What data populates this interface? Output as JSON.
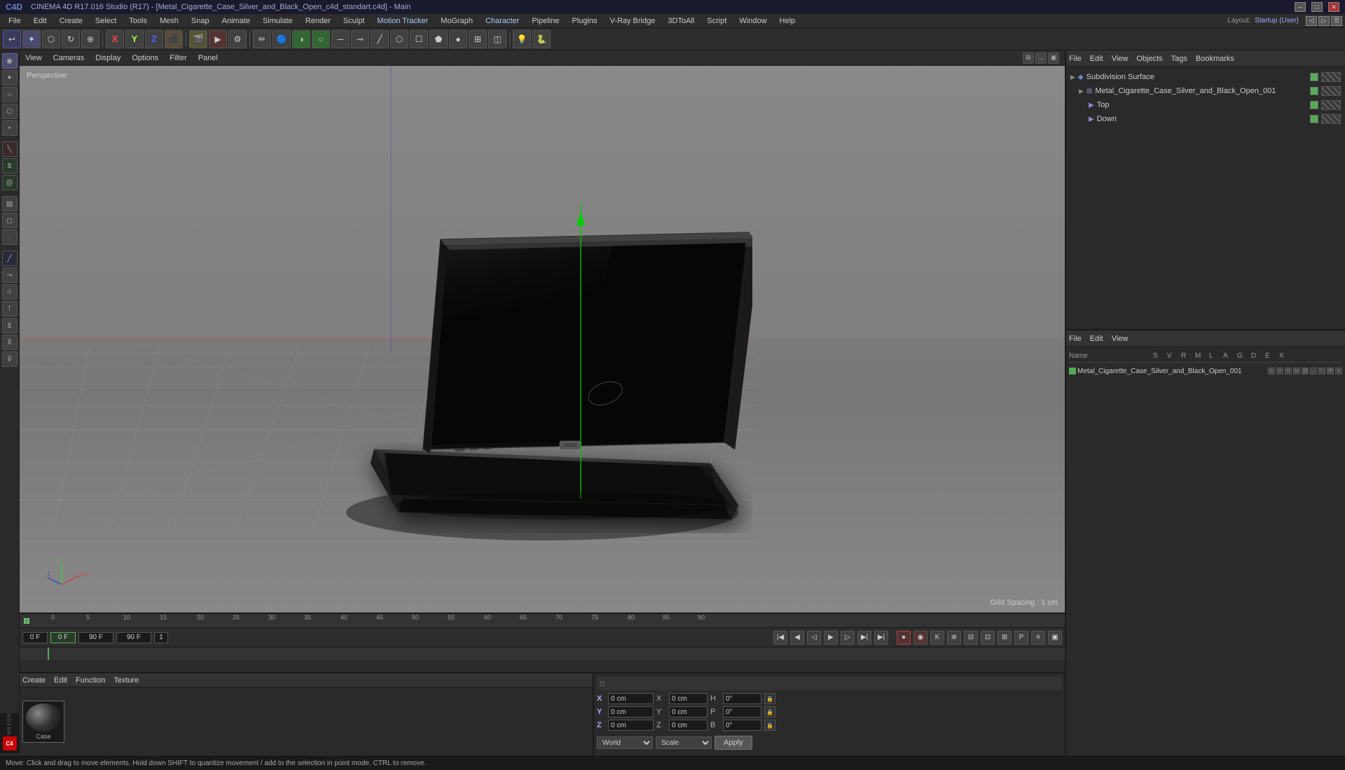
{
  "title_bar": {
    "title": "CINEMA 4D R17.016 Studio (R17) - [Metal_Cigarette_Case_Silver_and_Black_Open_c4d_standart.c4d] - Main",
    "min_btn": "─",
    "max_btn": "□",
    "close_btn": "✕"
  },
  "menu_bar": {
    "items": [
      "File",
      "Edit",
      "Create",
      "Select",
      "Tools",
      "Mesh",
      "Snap",
      "Animate",
      "Simulate",
      "Render",
      "Sculpt",
      "Motion Tracker",
      "MoGraph",
      "Character",
      "Pipeline",
      "Plugins",
      "V-Ray Bridge",
      "3DToAll",
      "Script",
      "Window",
      "Help"
    ]
  },
  "viewport": {
    "label": "Perspective",
    "header_menus": [
      "View",
      "Cameras",
      "Display",
      "Options",
      "Filter",
      "Panel"
    ],
    "grid_spacing": "Grid Spacing : 1 cm"
  },
  "layout": {
    "label": "Layout:",
    "value": "Startup (User)"
  },
  "scene_tree": {
    "header_menus": [
      "File",
      "Edit",
      "View",
      "Objects",
      "Tags",
      "Bookmarks"
    ],
    "items": [
      {
        "name": "Subdivision Surface",
        "level": 0,
        "icon": "◆",
        "has_check": true
      },
      {
        "name": "Metal_Cigarette_Case_Silver_and_Black_Open_001",
        "level": 1,
        "icon": "⊞",
        "has_check": true
      },
      {
        "name": "Top",
        "level": 2,
        "icon": "▶",
        "has_check": true
      },
      {
        "name": "Down",
        "level": 2,
        "icon": "▶",
        "has_check": true
      }
    ]
  },
  "attributes_panel": {
    "header_menus": [
      "File",
      "Edit",
      "View"
    ],
    "column_headers": [
      "Name",
      "S",
      "V",
      "R",
      "M",
      "L",
      "A",
      "G",
      "D",
      "E",
      "X"
    ],
    "rows": [
      {
        "name": "Metal_Cigarette_Case_Silver_and_Black_Open_001",
        "color": "#55aa55"
      }
    ]
  },
  "coordinates": {
    "header": "◻",
    "x_pos": {
      "label": "X",
      "value": "0 cm",
      "label2": "X",
      "value2": "0 cm",
      "label3": "H",
      "value3": "0°"
    },
    "y_pos": {
      "label": "Y",
      "value": "0 cm",
      "label2": "Y",
      "value2": "0 cm",
      "label3": "P",
      "value3": "0°"
    },
    "z_pos": {
      "label": "Z",
      "value": "0 cm",
      "label2": "Z",
      "value2": "0 cm",
      "label3": "B",
      "value3": "0°"
    },
    "world_label": "World",
    "scale_label": "Scale",
    "apply_label": "Apply"
  },
  "material_panel": {
    "header_menus": [
      "Create",
      "Edit",
      "Function",
      "Texture"
    ],
    "material_name": "Case"
  },
  "timeline": {
    "frame_start": "0 F",
    "frame_end": "90 F",
    "current_frame": "0 F",
    "markers": [
      "0",
      "5",
      "10",
      "15",
      "20",
      "25",
      "30",
      "35",
      "40",
      "45",
      "50",
      "55",
      "60",
      "65",
      "70",
      "75",
      "80",
      "85",
      "90"
    ]
  },
  "status_bar": {
    "message": "Move: Click and drag to move elements. Hold down SHIFT to quantize movement / add to the selection in point mode. CTRL to remove."
  },
  "sidebar_tools": [
    "◉",
    "✦",
    "○",
    "⬡",
    "+",
    "✕",
    "⊕",
    "⊗",
    "⊙",
    "◈",
    "▤",
    "🎬",
    "⬛",
    "⬢",
    "▲",
    "⬟",
    "●",
    "◐",
    "⊸",
    "⊹",
    "⊺",
    "⊻",
    "⊼",
    "⊽"
  ]
}
